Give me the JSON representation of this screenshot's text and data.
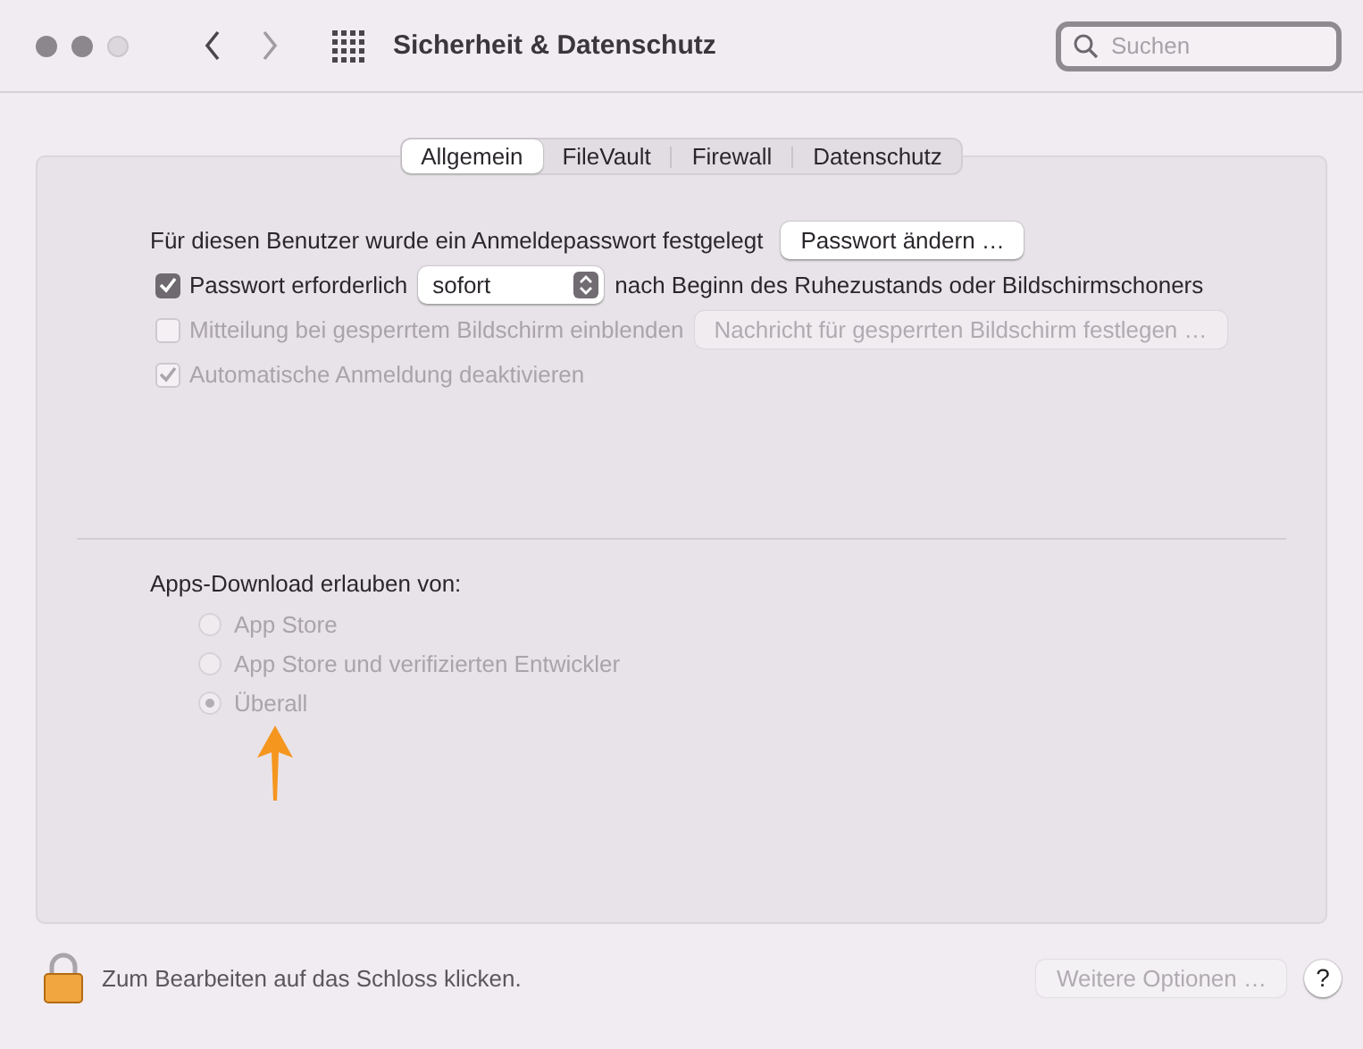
{
  "window": {
    "title": "Sicherheit & Datenschutz"
  },
  "search": {
    "placeholder": "Suchen"
  },
  "tabs": [
    {
      "label": "Allgemein",
      "selected": true
    },
    {
      "label": "FileVault",
      "selected": false
    },
    {
      "label": "Firewall",
      "selected": false
    },
    {
      "label": "Datenschutz",
      "selected": false
    }
  ],
  "general": {
    "password_text": "Für diesen Benutzer wurde ein Anmeldepasswort festgelegt",
    "password_button": "Passwort ändern …",
    "options": [
      {
        "kind": "dropdown",
        "label": "Passwort erforderlich",
        "checked": true,
        "disabled": false,
        "value": "sofort",
        "suffix": "nach Beginn des Ruhezustands oder Bildschirmschoners"
      },
      {
        "kind": "button",
        "label": "Mitteilung bei gesperrtem Bildschirm einblenden",
        "checked": false,
        "disabled": true,
        "button": "Nachricht für gesperrten Bildschirm festlegen …"
      },
      {
        "kind": "plain",
        "label": "Automatische Anmeldung deaktivieren",
        "checked": true,
        "disabled": true
      }
    ]
  },
  "apps_download": {
    "heading": "Apps-Download erlauben von:",
    "choices": [
      {
        "label": "App Store",
        "selected": false,
        "disabled": true
      },
      {
        "label": "App Store und verifizierten Entwickler",
        "selected": false,
        "disabled": true
      },
      {
        "label": "Überall",
        "selected": true,
        "disabled": true
      }
    ]
  },
  "footer": {
    "lock_text": "Zum Bearbeiten auf das Schloss klicken.",
    "more_button": {
      "label": "Weitere Optionen …",
      "disabled": true
    },
    "help": "?"
  }
}
